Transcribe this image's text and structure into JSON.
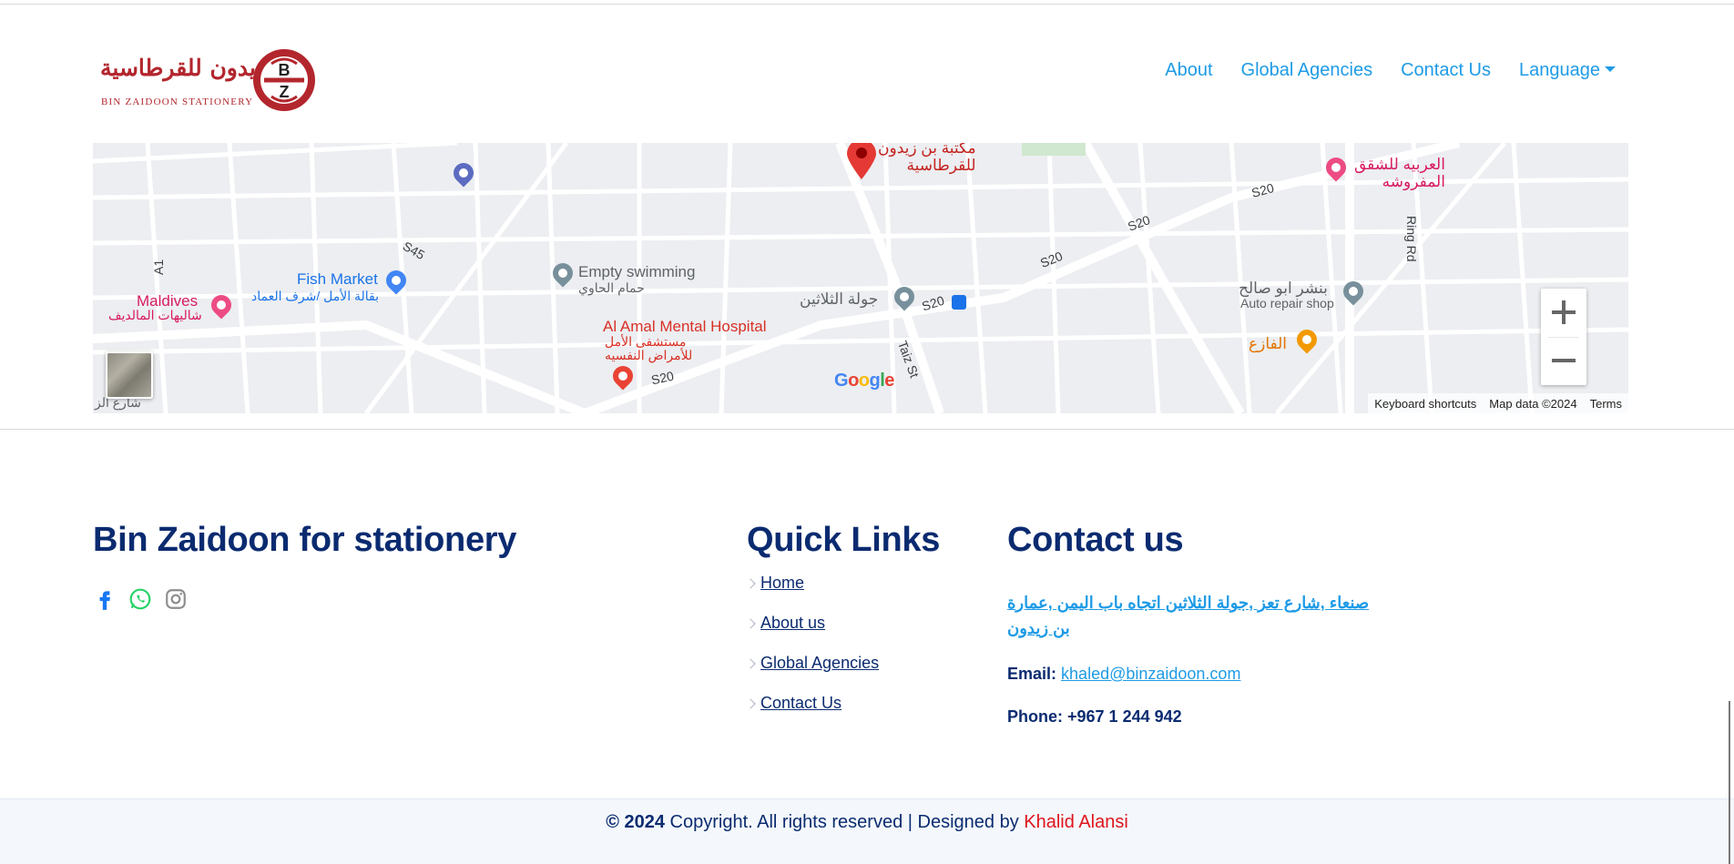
{
  "header": {
    "logo_ar": "بن زيدون للقرطاسية",
    "logo_en": "BIN ZAIDOON STATIONERY",
    "logo_letters": [
      "B",
      "Z"
    ],
    "nav": [
      {
        "label": "About"
      },
      {
        "label": "Global Agencies"
      },
      {
        "label": "Contact Us"
      },
      {
        "label": "Language"
      }
    ]
  },
  "map": {
    "labels": {
      "store": "مكتبة بن زيدون\nللقرطاسية",
      "store_line1": "مكتبة بن زيدون",
      "store_line2": "للقرطاسية",
      "arabiya_line1": "العربيه للشقق",
      "arabiya_line2": "المفروشه",
      "s20_a": "S20",
      "s20_b": "S20",
      "s20_c": "S20",
      "s20_d": "S20",
      "s20_e": "S20",
      "ring_rd": "Ring Rd",
      "a1": "A1",
      "s45": "S45",
      "empty_swimming": "Empty swimming",
      "hammam": "حمام الحاوي",
      "fish_market": "Fish Market",
      "baqala": "بقالة الأمل /شرف العماد",
      "maldives": "Maldives",
      "maldives_ar": "شاليهات المالديف",
      "thalatheen": "جولة الثلاثين",
      "taiz_st": "Taiz St",
      "al_amal_hospital": "Al Amal Mental Hospital",
      "al_amal_ar1": "مستشفى الأمل",
      "al_amal_ar2": "للأمراض النفسيه",
      "auto_repair_ar": "بنشر ابو صالح",
      "auto_repair": "Auto repair shop",
      "alfazia": "الفازع",
      "corner_ar": "شارع الز"
    },
    "google": "Google",
    "footer": [
      "Keyboard shortcuts",
      "Map data ©2024",
      "Terms"
    ],
    "zoom_in": "+",
    "zoom_out": "−"
  },
  "footer": {
    "brand_title": "Bin Zaidoon for stationery",
    "social_icons": [
      "facebook-icon",
      "whatsapp-icon",
      "instagram-icon"
    ],
    "quick_links_title": "Quick Links",
    "quick_links": [
      {
        "label": "Home"
      },
      {
        "label": "About us"
      },
      {
        "label": "Global Agencies"
      },
      {
        "label": "Contact Us"
      }
    ],
    "contact_title": "Contact us",
    "address_line1": "صنعاء ,شارع تعز ,جولة الثلاثين اتجاه باب اليمن ,عمارة",
    "address_line2": "بن زيدون",
    "email_label": "Email:",
    "email": "khaled@binzaidoon.com",
    "phone_label": "Phone:",
    "phone": "+967 1 244 942"
  },
  "bottom": {
    "year": "© 2024",
    "text": "Copyright. All rights reserved | Designed by",
    "author": "Khalid Alansi"
  },
  "colors": {
    "accent": "#1e9be6",
    "navy": "#0b2b70",
    "brand_red": "#b3262d",
    "author_red": "#e0141e"
  }
}
